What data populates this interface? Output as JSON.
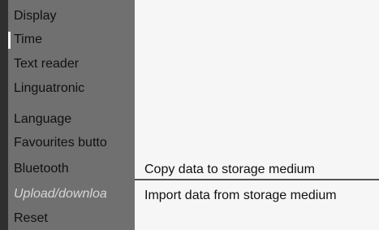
{
  "menu": {
    "items": [
      {
        "label": "Display"
      },
      {
        "label": "Time"
      },
      {
        "label": "Text reader"
      },
      {
        "label": "Linguatronic"
      },
      {
        "label": "Language"
      },
      {
        "label": "Favourites butto"
      },
      {
        "label": "Bluetooth"
      },
      {
        "label": "Upload/downloa"
      },
      {
        "label": "Reset"
      }
    ],
    "selected_label": "Upload/downloa"
  },
  "submenu": {
    "items": [
      {
        "label": "Copy data to storage medium"
      },
      {
        "label": "Import data from storage medium"
      }
    ]
  }
}
